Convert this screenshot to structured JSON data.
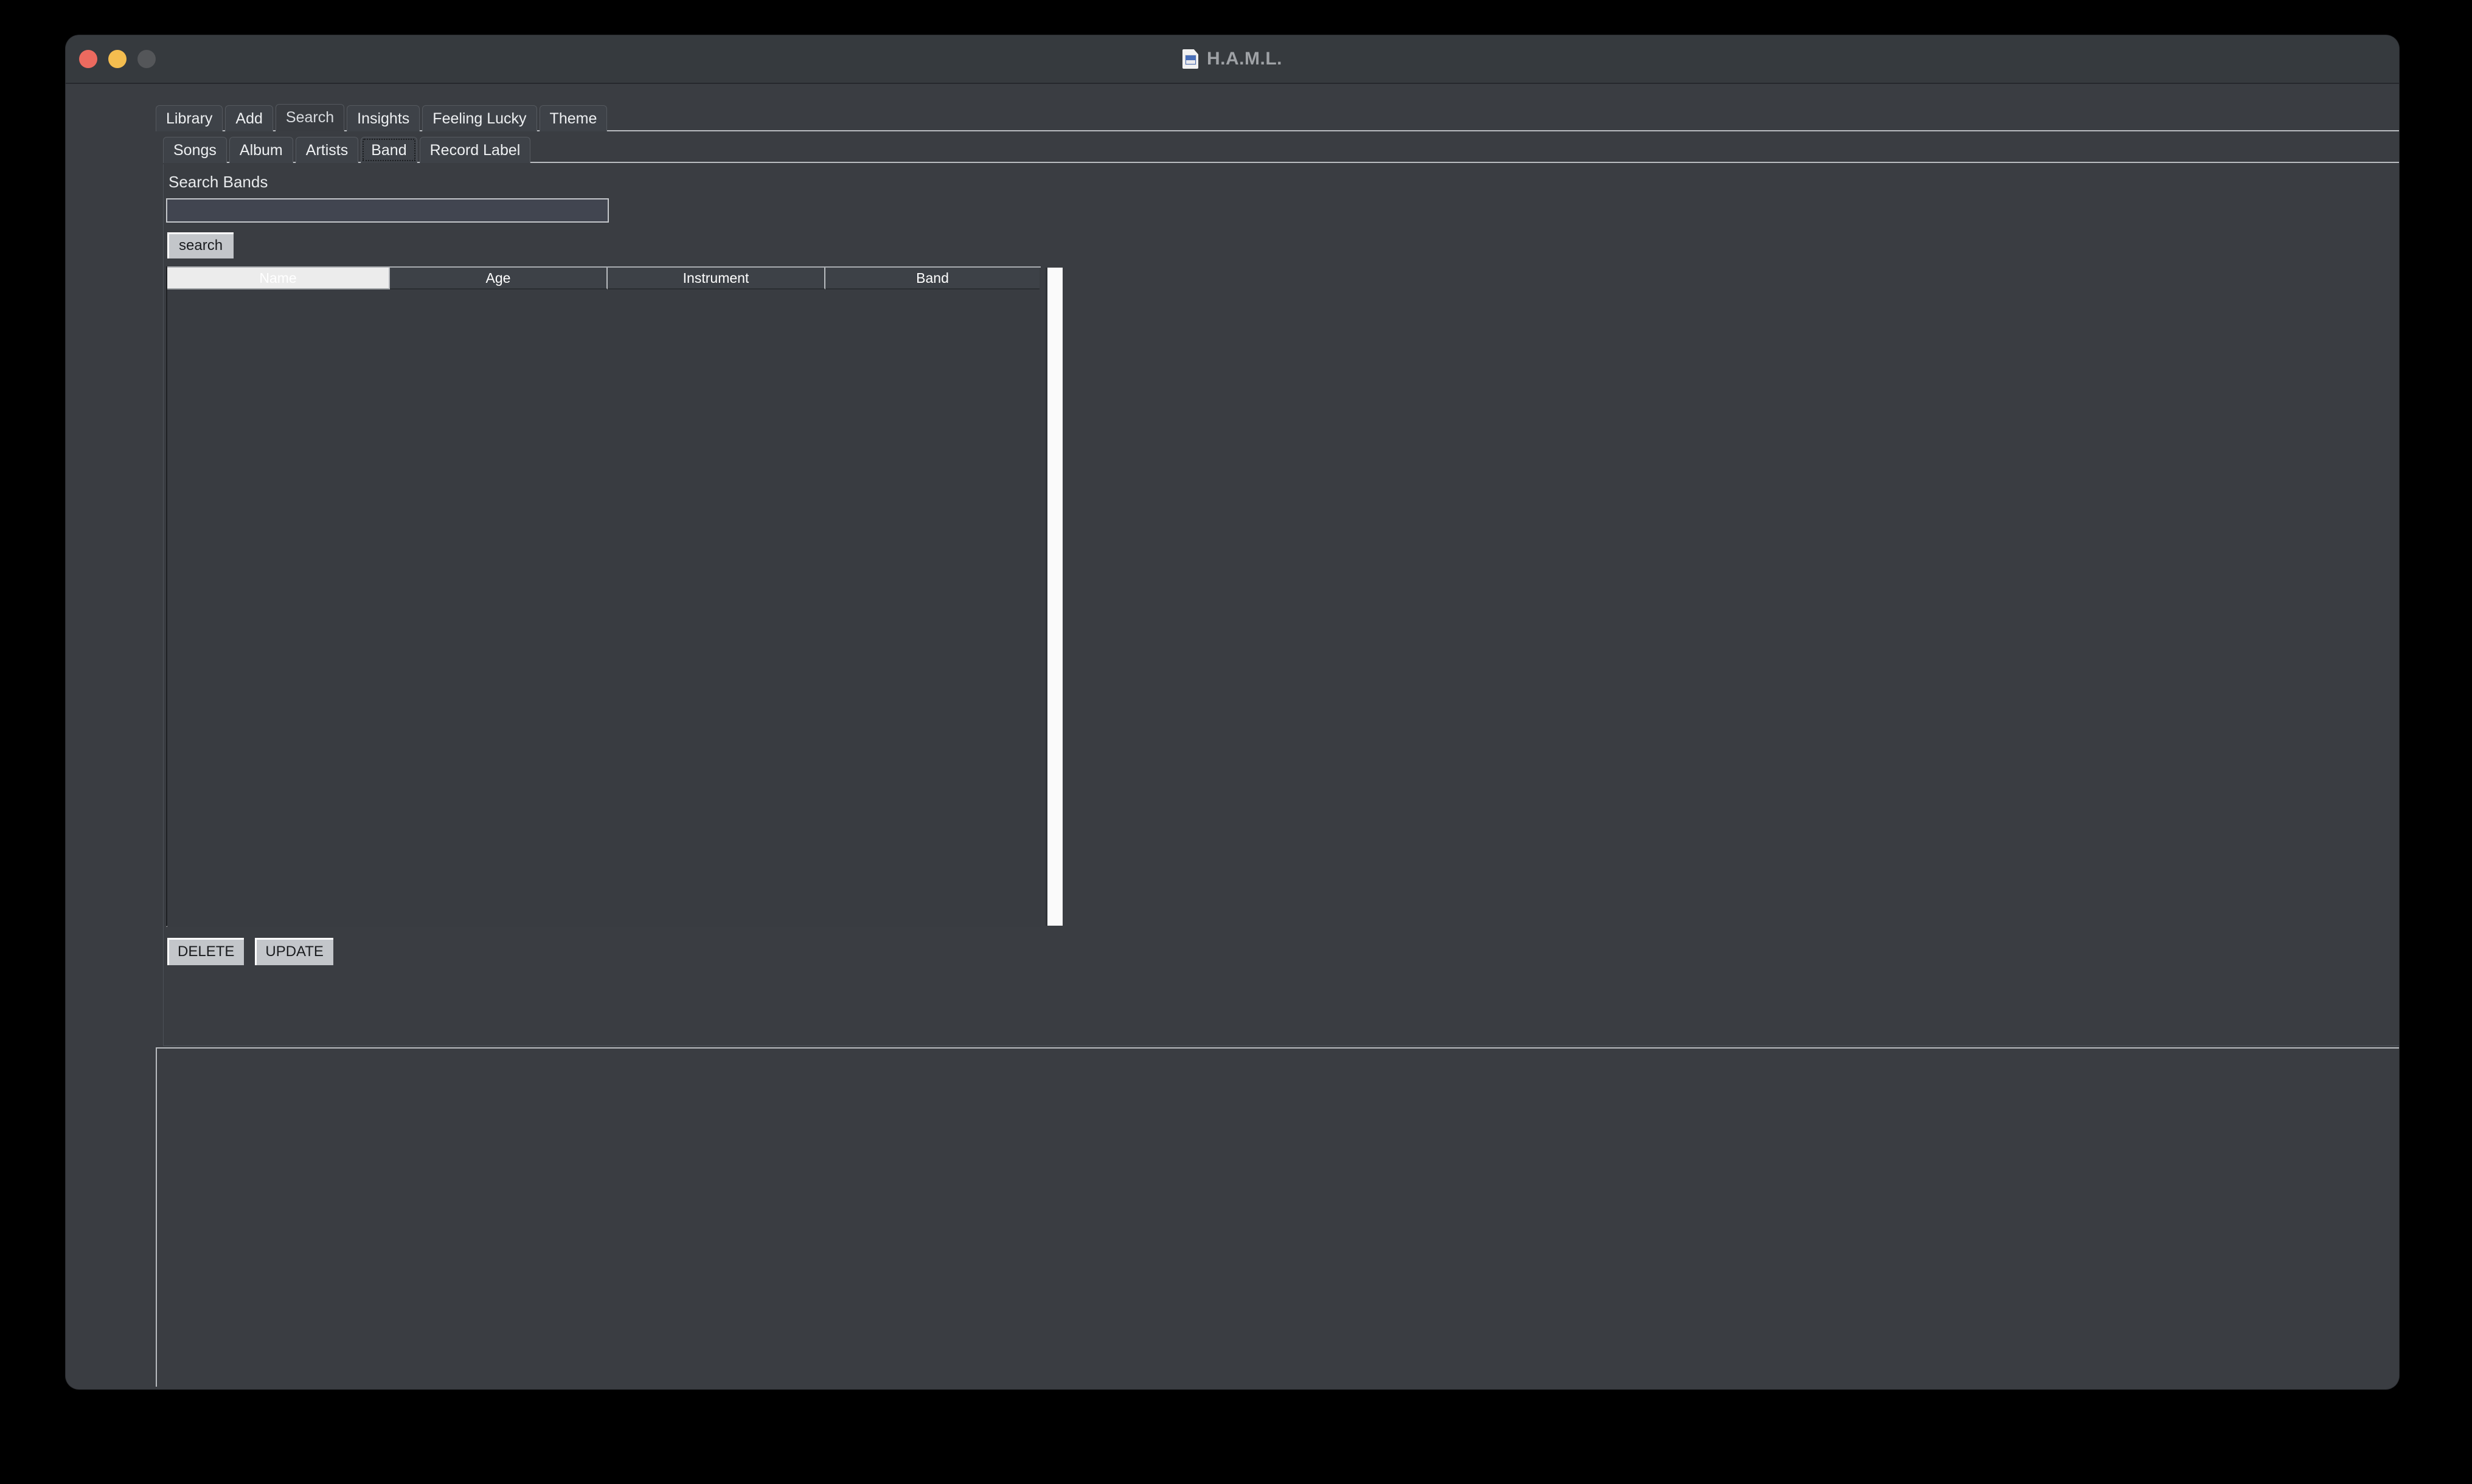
{
  "window": {
    "title": "H.A.M.L.",
    "title_icon": "document-icon",
    "traffic_lights": [
      {
        "name": "close",
        "color": "#ec6a5f"
      },
      {
        "name": "minimize",
        "color": "#f4bd4f"
      },
      {
        "name": "zoom",
        "color": "#545659"
      }
    ]
  },
  "main_tabs": [
    {
      "label": "Library",
      "active": false
    },
    {
      "label": "Add",
      "active": false
    },
    {
      "label": "Search",
      "active": true
    },
    {
      "label": "Insights",
      "active": false
    },
    {
      "label": "Feeling Lucky",
      "active": false
    },
    {
      "label": "Theme",
      "active": false
    }
  ],
  "sub_tabs": [
    {
      "label": "Songs",
      "focused": false
    },
    {
      "label": "Album",
      "focused": false
    },
    {
      "label": "Artists",
      "focused": false
    },
    {
      "label": "Band",
      "focused": true
    },
    {
      "label": "Record Label",
      "focused": false
    }
  ],
  "search_panel": {
    "label": "Search Bands",
    "input_value": "",
    "input_placeholder": "",
    "button_label": "search"
  },
  "results_table": {
    "columns": [
      {
        "key": "name",
        "label": "Name",
        "highlighted": true
      },
      {
        "key": "age",
        "label": "Age",
        "highlighted": false
      },
      {
        "key": "instrument",
        "label": "Instrument",
        "highlighted": false
      },
      {
        "key": "band",
        "label": "Band",
        "highlighted": false
      }
    ],
    "rows": [],
    "scrollbar": "vertical-scrollbar"
  },
  "actions": [
    {
      "label": "DELETE"
    },
    {
      "label": "UPDATE"
    }
  ],
  "colors": {
    "window_bg": "#3a3d42",
    "titlebar_bg": "#363a3e",
    "tab_bg": "#3e4248",
    "tab_active_bg": "#393c41",
    "text": "#eef0f2",
    "button_face": "#c3c6ca",
    "border_light": "#b9bcc0",
    "header_highlight": "#ececec",
    "scrollbar": "#fafafa"
  }
}
